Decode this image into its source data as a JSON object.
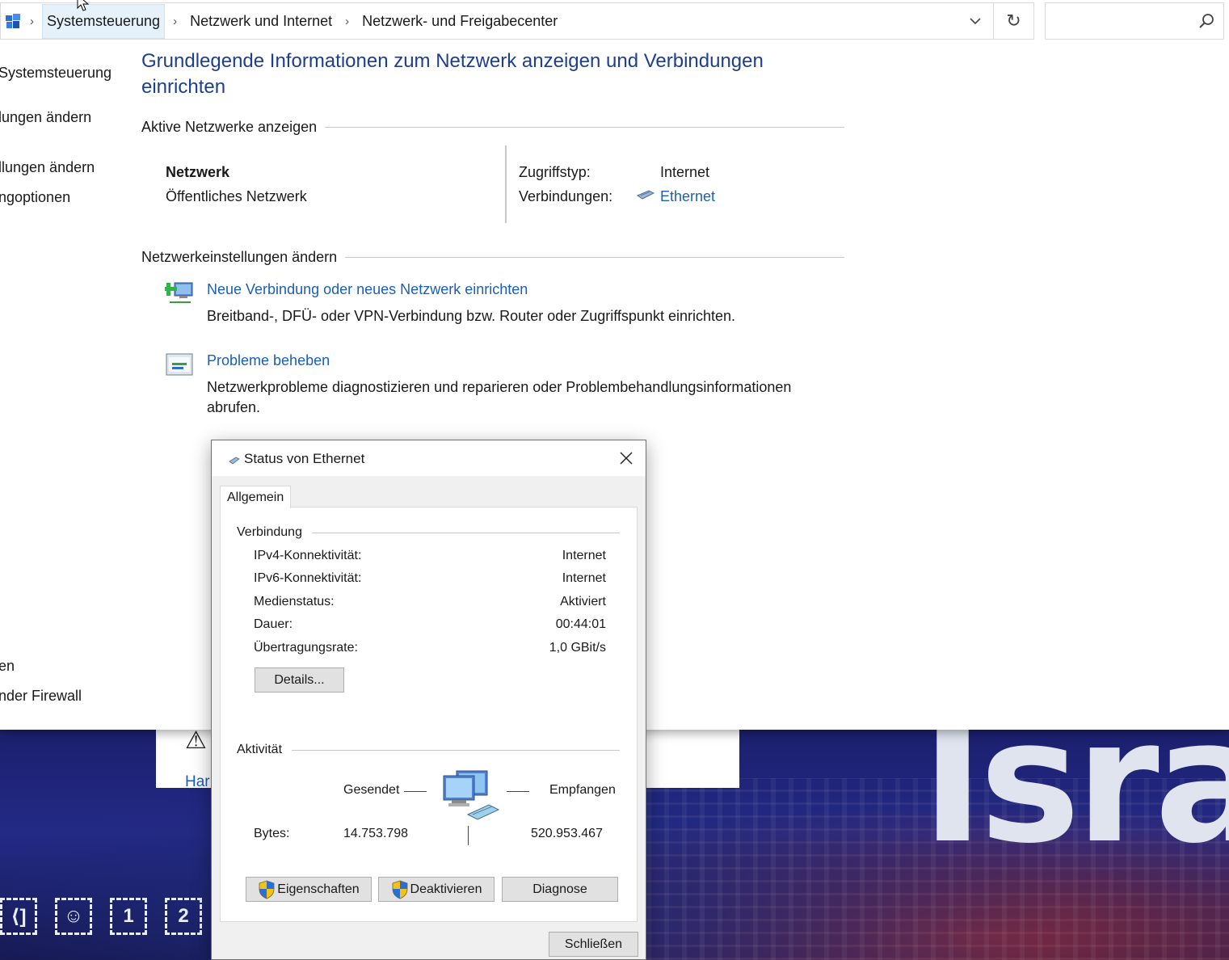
{
  "breadcrumb": {
    "items": [
      "Systemsteuerung",
      "Netzwerk und Internet",
      "Netzwerk- und Freigabecenter"
    ]
  },
  "left_nav": {
    "items": [
      "Systemsteuerung",
      "lungen ändern",
      "llungen ändern",
      "ngoptionen",
      "en",
      "nder Firewall"
    ]
  },
  "main": {
    "title": "Grundlegende Informationen zum Netzwerk anzeigen und Verbindungen einrichten",
    "active_networks_heading": "Aktive Netzwerke anzeigen",
    "network": {
      "name": "Netzwerk",
      "type": "Öffentliches Netzwerk",
      "access_type_label": "Zugriffstyp:",
      "access_type_value": "Internet",
      "connections_label": "Verbindungen:",
      "connections_value": "Ethernet"
    },
    "change_settings_heading": "Netzwerkeinstellungen ändern",
    "tasks": [
      {
        "link": "Neue Verbindung oder neues Netzwerk einrichten",
        "desc": "Breitband-, DFÜ- oder VPN-Verbindung bzw. Router oder Zugriffspunkt einrichten."
      },
      {
        "link": "Probleme beheben",
        "desc": "Netzwerkprobleme diagnostizieren und reparieren oder Problembehandlungsinformationen abrufen."
      }
    ],
    "behind_link": "Har"
  },
  "dialog": {
    "title": "Status von Ethernet",
    "tab": "Allgemein",
    "connection_group": "Verbindung",
    "rows": [
      {
        "label": "IPv4-Konnektivität:",
        "value": "Internet"
      },
      {
        "label": "IPv6-Konnektivität:",
        "value": "Internet"
      },
      {
        "label": "Medienstatus:",
        "value": "Aktiviert"
      },
      {
        "label": "Dauer:",
        "value": "00:44:01"
      },
      {
        "label": "Übertragungsrate:",
        "value": "1,0 GBit/s"
      }
    ],
    "details_button": "Details...",
    "activity_group": "Aktivität",
    "sent_label": "Gesendet",
    "received_label": "Empfangen",
    "bytes_label": "Bytes:",
    "bytes_sent": "14.753.798",
    "bytes_received": "520.953.467",
    "buttons": {
      "properties": "Eigenschaften",
      "disable": "Deaktivieren",
      "diagnose": "Diagnose",
      "close": "Schließen"
    }
  },
  "background": {
    "overlay_text": "Israe",
    "hud_items": [
      "⟨]",
      "☺",
      "1",
      "2"
    ]
  },
  "colors": {
    "title_blue": "#1e3f8f",
    "link_blue": "#1a5fb4",
    "button_face": "#e1e1e1"
  }
}
